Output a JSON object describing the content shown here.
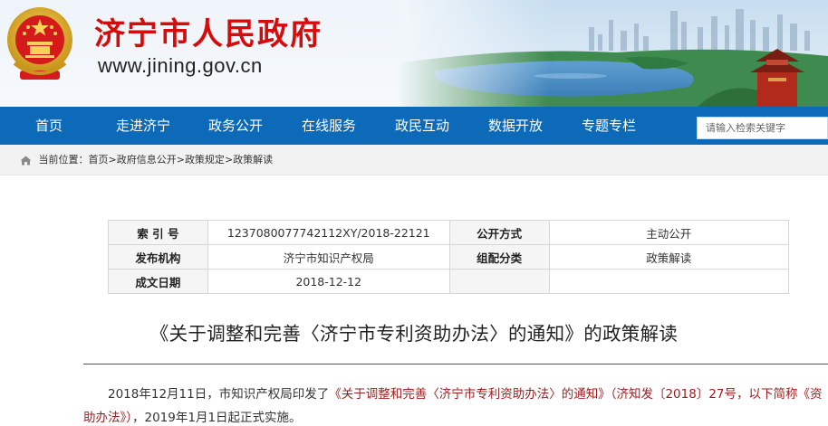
{
  "header": {
    "site_title": "济宁市人民政府",
    "site_url": "www.jining.gov.cn",
    "emblem_icon": "national-emblem-icon",
    "title_color": "#d60b0b"
  },
  "nav": {
    "bar_color": "#0d6ab8",
    "items": [
      "首页",
      "走进济宁",
      "政务公开",
      "在线服务",
      "政民互动",
      "数据开放",
      "专题专栏"
    ],
    "search_placeholder": "请输入检索关键字"
  },
  "breadcrumb": {
    "icon": "home-icon",
    "prefix": "当前位置：",
    "path": [
      "首页",
      "政府信息公开",
      "政策规定",
      "政策解读"
    ],
    "separator": ">"
  },
  "info": {
    "rows": [
      {
        "label1": "索 引 号",
        "value1": "1237080077742112XY/2018-22121",
        "label2": "公开方式",
        "value2": "主动公开"
      },
      {
        "label1": "发布机构",
        "value1": "济宁市知识产权局",
        "label2": "组配分类",
        "value2": "政策解读"
      },
      {
        "label1": "成文日期",
        "value1": "2018-12-12",
        "label2": "",
        "value2": ""
      }
    ]
  },
  "article": {
    "title": "《关于调整和完善〈济宁市专利资助办法〉的通知》的政策解读",
    "para_start": "2018年12月11日，市知识产权局印发了",
    "para_highlight": "《关于调整和完善〈济宁市专利资助办法〉的通知》（济知发〔2018〕27号，以下简称《资助办法》）",
    "para_end": "，2019年1月1日起正式实施。",
    "highlight_color": "#9a1d1d"
  }
}
